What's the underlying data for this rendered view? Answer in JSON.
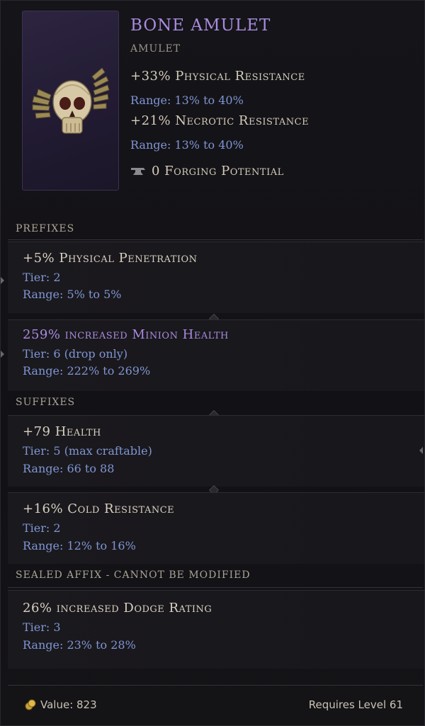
{
  "item": {
    "name": "BONE AMULET",
    "type": "AMULET",
    "implicits": [
      {
        "text": "+33% Physical Resistance",
        "range": "Range: 13% to 40%"
      },
      {
        "text": "+21% Necrotic Resistance",
        "range": "Range: 13% to 40%"
      }
    ],
    "forging": "0 Forging Potential"
  },
  "sections": {
    "prefixes": "PREFIXES",
    "suffixes": "SUFFIXES",
    "sealed": "SEALED AFFIX - CANNOT BE MODIFIED"
  },
  "affixes": [
    {
      "name": "+5% Physical Penetration",
      "tier": "Tier: 2",
      "range": "Range: 5% to 5%"
    },
    {
      "name": "259% increased Minion Health",
      "tier": "Tier: 6 (drop only)",
      "range": "Range: 222% to 269%"
    },
    {
      "name": "+79 Health",
      "tier": "Tier: 5 (max craftable)",
      "range": "Range: 66 to 88"
    },
    {
      "name": "+16% Cold Resistance",
      "tier": "Tier: 2",
      "range": "Range: 12% to 16%"
    },
    {
      "name": "26% increased Dodge Rating",
      "tier": "Tier: 3",
      "range": "Range: 23% to 28%"
    }
  ],
  "footer": {
    "value": "Value: 823",
    "level": "Requires Level 61"
  },
  "colors": {
    "title": "#a98be0",
    "range_text": "#7f95d4",
    "background": "#121115"
  }
}
